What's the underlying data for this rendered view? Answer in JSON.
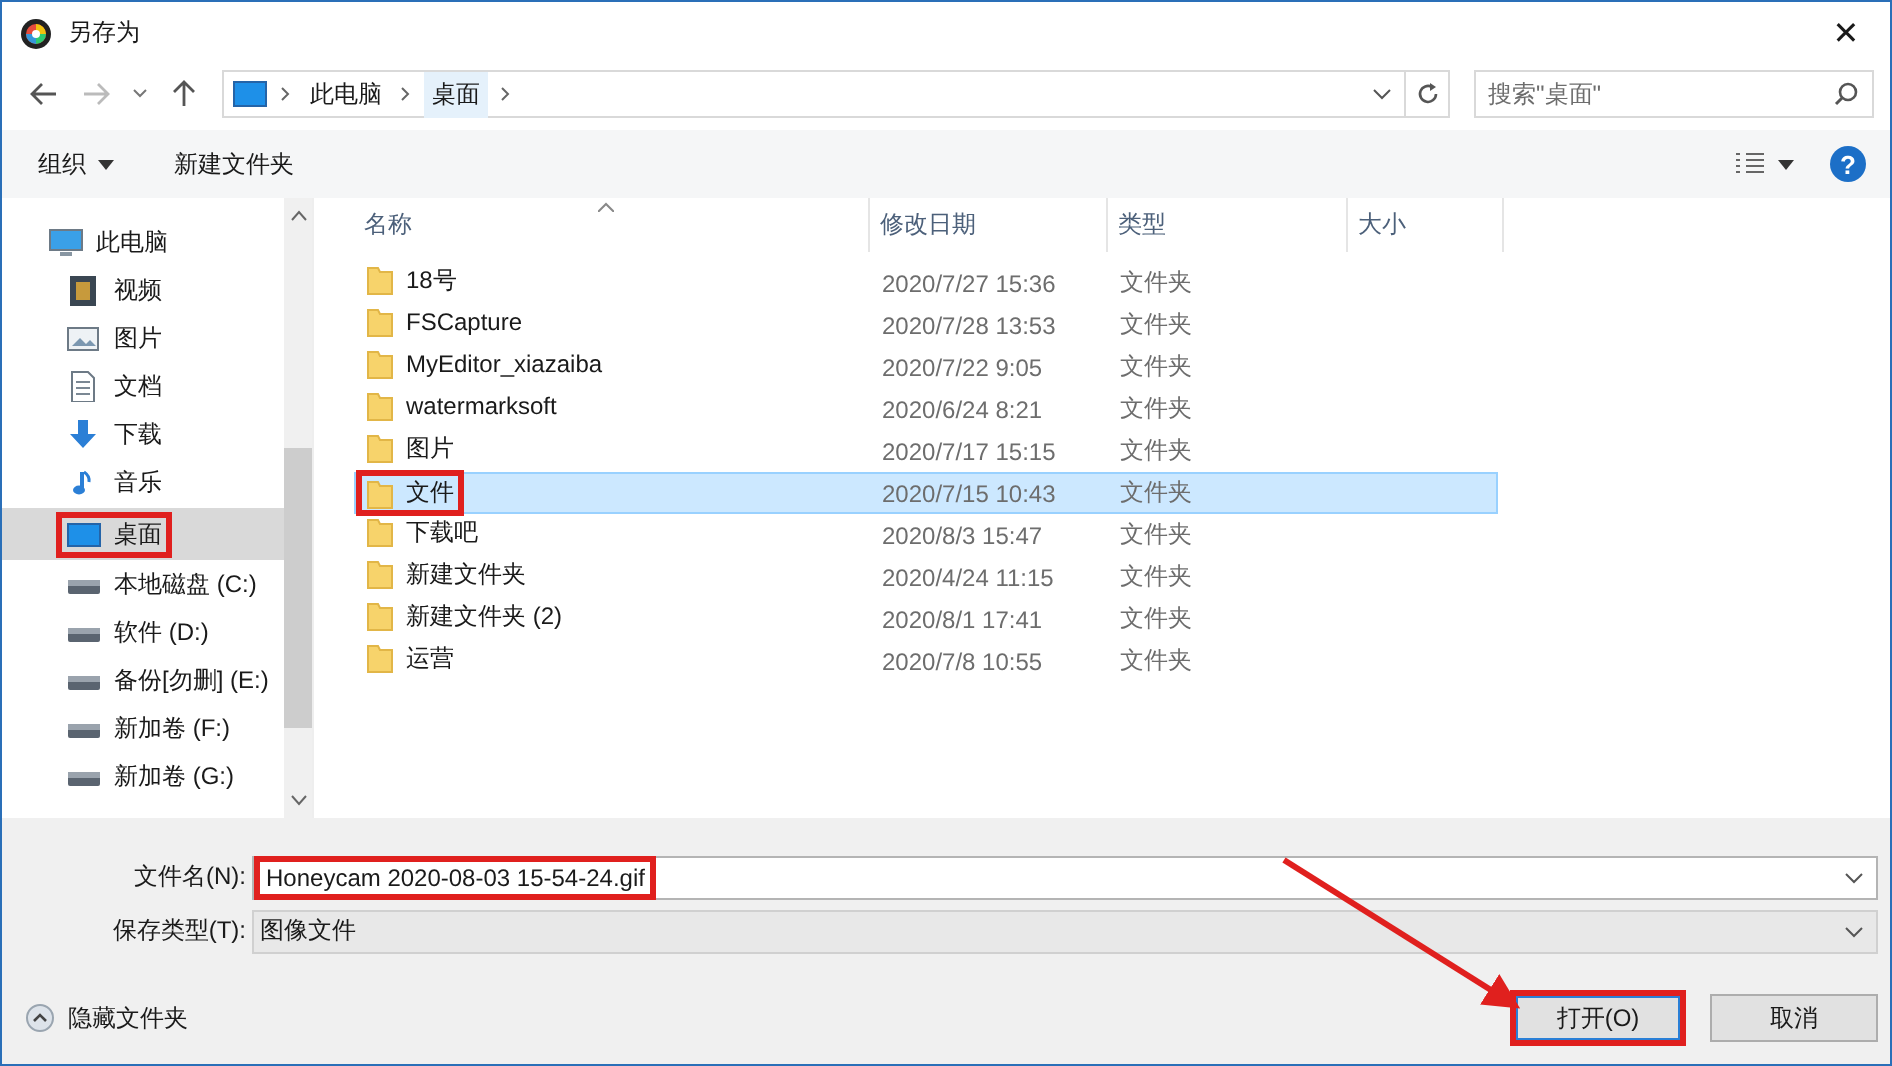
{
  "window": {
    "title": "另存为",
    "close": "✕"
  },
  "nav": {
    "path": [
      "此电脑",
      "桌面"
    ],
    "search": {
      "placeholder": "搜索\"桌面\""
    }
  },
  "toolbar": {
    "organize": "组织",
    "new_folder": "新建文件夹",
    "help": "?"
  },
  "sidebar": {
    "items": [
      {
        "label": "此电脑",
        "kind": "pc",
        "selected": false,
        "highlighted": false,
        "children": [
          {
            "label": "视频",
            "kind": "video",
            "selected": false,
            "highlighted": false
          },
          {
            "label": "图片",
            "kind": "pictures",
            "selected": false,
            "highlighted": false
          },
          {
            "label": "文档",
            "kind": "document",
            "selected": false,
            "highlighted": false
          },
          {
            "label": "下载",
            "kind": "download",
            "selected": false,
            "highlighted": false
          },
          {
            "label": "音乐",
            "kind": "music",
            "selected": false,
            "highlighted": false
          },
          {
            "label": "桌面",
            "kind": "desktop",
            "selected": true,
            "highlighted": true
          },
          {
            "label": "本地磁盘 (C:)",
            "kind": "drive",
            "selected": false,
            "highlighted": false
          },
          {
            "label": "软件 (D:)",
            "kind": "drive",
            "selected": false,
            "highlighted": false
          },
          {
            "label": "备份[勿删] (E:)",
            "kind": "drive",
            "selected": false,
            "highlighted": false
          },
          {
            "label": "新加卷 (F:)",
            "kind": "drive",
            "selected": false,
            "highlighted": false
          },
          {
            "label": "新加卷 (G:)",
            "kind": "drive",
            "selected": false,
            "highlighted": false
          }
        ]
      }
    ]
  },
  "table": {
    "columns": [
      "名称",
      "修改日期",
      "类型",
      "大小"
    ],
    "rows": [
      {
        "name": "18号",
        "modified": "2020/7/27 15:36",
        "type": "文件夹",
        "selected": false,
        "highlighted": false
      },
      {
        "name": "FSCapture",
        "modified": "2020/7/28 13:53",
        "type": "文件夹",
        "selected": false,
        "highlighted": false
      },
      {
        "name": "MyEditor_xiazaiba",
        "modified": "2020/7/22 9:05",
        "type": "文件夹",
        "selected": false,
        "highlighted": false
      },
      {
        "name": "watermarksoft",
        "modified": "2020/6/24 8:21",
        "type": "文件夹",
        "selected": false,
        "highlighted": false
      },
      {
        "name": "图片",
        "modified": "2020/7/17 15:15",
        "type": "文件夹",
        "selected": false,
        "highlighted": false
      },
      {
        "name": "文件",
        "modified": "2020/7/15 10:43",
        "type": "文件夹",
        "selected": true,
        "highlighted": true
      },
      {
        "name": "下载吧",
        "modified": "2020/8/3 15:47",
        "type": "文件夹",
        "selected": false,
        "highlighted": false
      },
      {
        "name": "新建文件夹",
        "modified": "2020/4/24 11:15",
        "type": "文件夹",
        "selected": false,
        "highlighted": false
      },
      {
        "name": "新建文件夹 (2)",
        "modified": "2020/8/1 17:41",
        "type": "文件夹",
        "selected": false,
        "highlighted": false
      },
      {
        "name": "运营",
        "modified": "2020/7/8 10:55",
        "type": "文件夹",
        "selected": false,
        "highlighted": false
      }
    ]
  },
  "filename": {
    "label": "文件名(N):",
    "value": "Honeycam 2020-08-03 15-54-24.gif",
    "highlighted": true
  },
  "filetype": {
    "label": "保存类型(T):",
    "value": "图像文件"
  },
  "footer": {
    "hide_folders": "隐藏文件夹",
    "buttons": [
      {
        "label": "打开(O)",
        "default": true,
        "highlighted": true
      },
      {
        "label": "取消",
        "default": false,
        "highlighted": false
      }
    ]
  },
  "pointer_arrow": true
}
